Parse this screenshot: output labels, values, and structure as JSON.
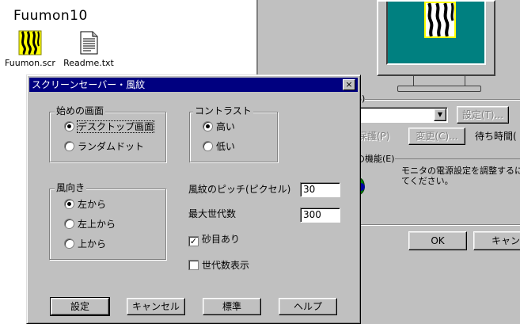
{
  "folder": {
    "title": "Fuumon10",
    "items": [
      {
        "label": "Fuumon.scr",
        "icon": "screensaver-file-icon"
      },
      {
        "label": "Readme.txt",
        "icon": "text-document-icon"
      }
    ]
  },
  "props": {
    "frag_s": "S)",
    "settings_button": "設定(T)...",
    "password_checkbox": "保護(P)",
    "change_button": "変更(C)...",
    "wait_label": "待ち時間(",
    "energy_group": "の機能(E)",
    "energy_text_1": "モニタの電源設定を調整するにに",
    "energy_text_2": "てください。",
    "ok_button": "OK",
    "cancel_button": "キャンセ"
  },
  "dialog": {
    "title": "スクリーンセーバー・風紋",
    "close_glyph": "×",
    "start_group": {
      "label": "始めの画面",
      "options": [
        "デスクトップ画面",
        "ランダムドット"
      ],
      "selected": 0
    },
    "contrast_group": {
      "label": "コントラスト",
      "options": [
        "高い",
        "低い"
      ],
      "selected": 0
    },
    "wind_group": {
      "label": "風向き",
      "options": [
        "左から",
        "左上から",
        "上から"
      ],
      "selected": 0
    },
    "pitch": {
      "label": "風紋のピッチ(ピクセル)",
      "value": "30"
    },
    "max_gen": {
      "label": "最大世代数",
      "value": "300"
    },
    "sand_eye": {
      "label": "砂目あり",
      "checked": true
    },
    "show_gen": {
      "label": "世代数表示",
      "checked": false
    },
    "buttons": {
      "ok": "設定",
      "cancel": "キャンセル",
      "default": "標準",
      "help": "ヘルプ"
    }
  }
}
